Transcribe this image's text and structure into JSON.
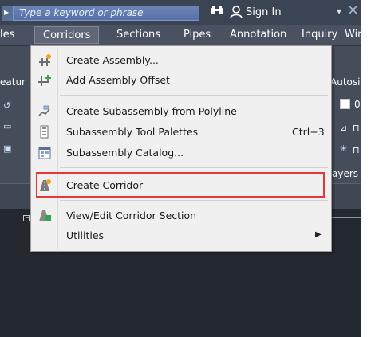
{
  "titlebar": {
    "search_placeholder": "Type a keyword or phrase",
    "signin_label": "Sign In",
    "icons": [
      "menu-arrow-icon",
      "binoculars-icon",
      "user-icon",
      "chevron-down-icon",
      "close-icon"
    ]
  },
  "ribbon": {
    "tabs": [
      {
        "label": "les"
      },
      {
        "label": "Corridors",
        "active": true
      },
      {
        "label": "Sections"
      },
      {
        "label": "Pipes"
      },
      {
        "label": "Annotation"
      },
      {
        "label": "Inquiry"
      },
      {
        "label": "Wir"
      }
    ]
  },
  "panel": {
    "left_label": "eatur",
    "right_label": "Autosign",
    "value_label": "0",
    "layers_label": "ayers"
  },
  "menu": {
    "items": [
      {
        "label": "Create Assembly...",
        "icon": "create-assembly-icon"
      },
      {
        "label": "Add Assembly Offset",
        "icon": "assembly-offset-icon"
      },
      {
        "label": "Create Subassembly from Polyline",
        "icon": "subassembly-polyline-icon"
      },
      {
        "label": "Subassembly Tool Palettes",
        "shortcut": "Ctrl+3",
        "icon": "tool-palettes-icon"
      },
      {
        "label": "Subassembly Catalog...",
        "icon": "catalog-icon"
      },
      {
        "label": "Create Corridor",
        "icon": "create-corridor-icon"
      },
      {
        "label": "View/Edit Corridor Section",
        "icon": "corridor-section-icon"
      },
      {
        "label": "Utilities",
        "submenu_arrow": "▶"
      }
    ]
  },
  "colors": {
    "titlebar": "#3b4453",
    "search": "#5671a9",
    "menu_bg": "#f0f0f0",
    "highlight": "#e2383c",
    "canvas": "#24282f"
  }
}
